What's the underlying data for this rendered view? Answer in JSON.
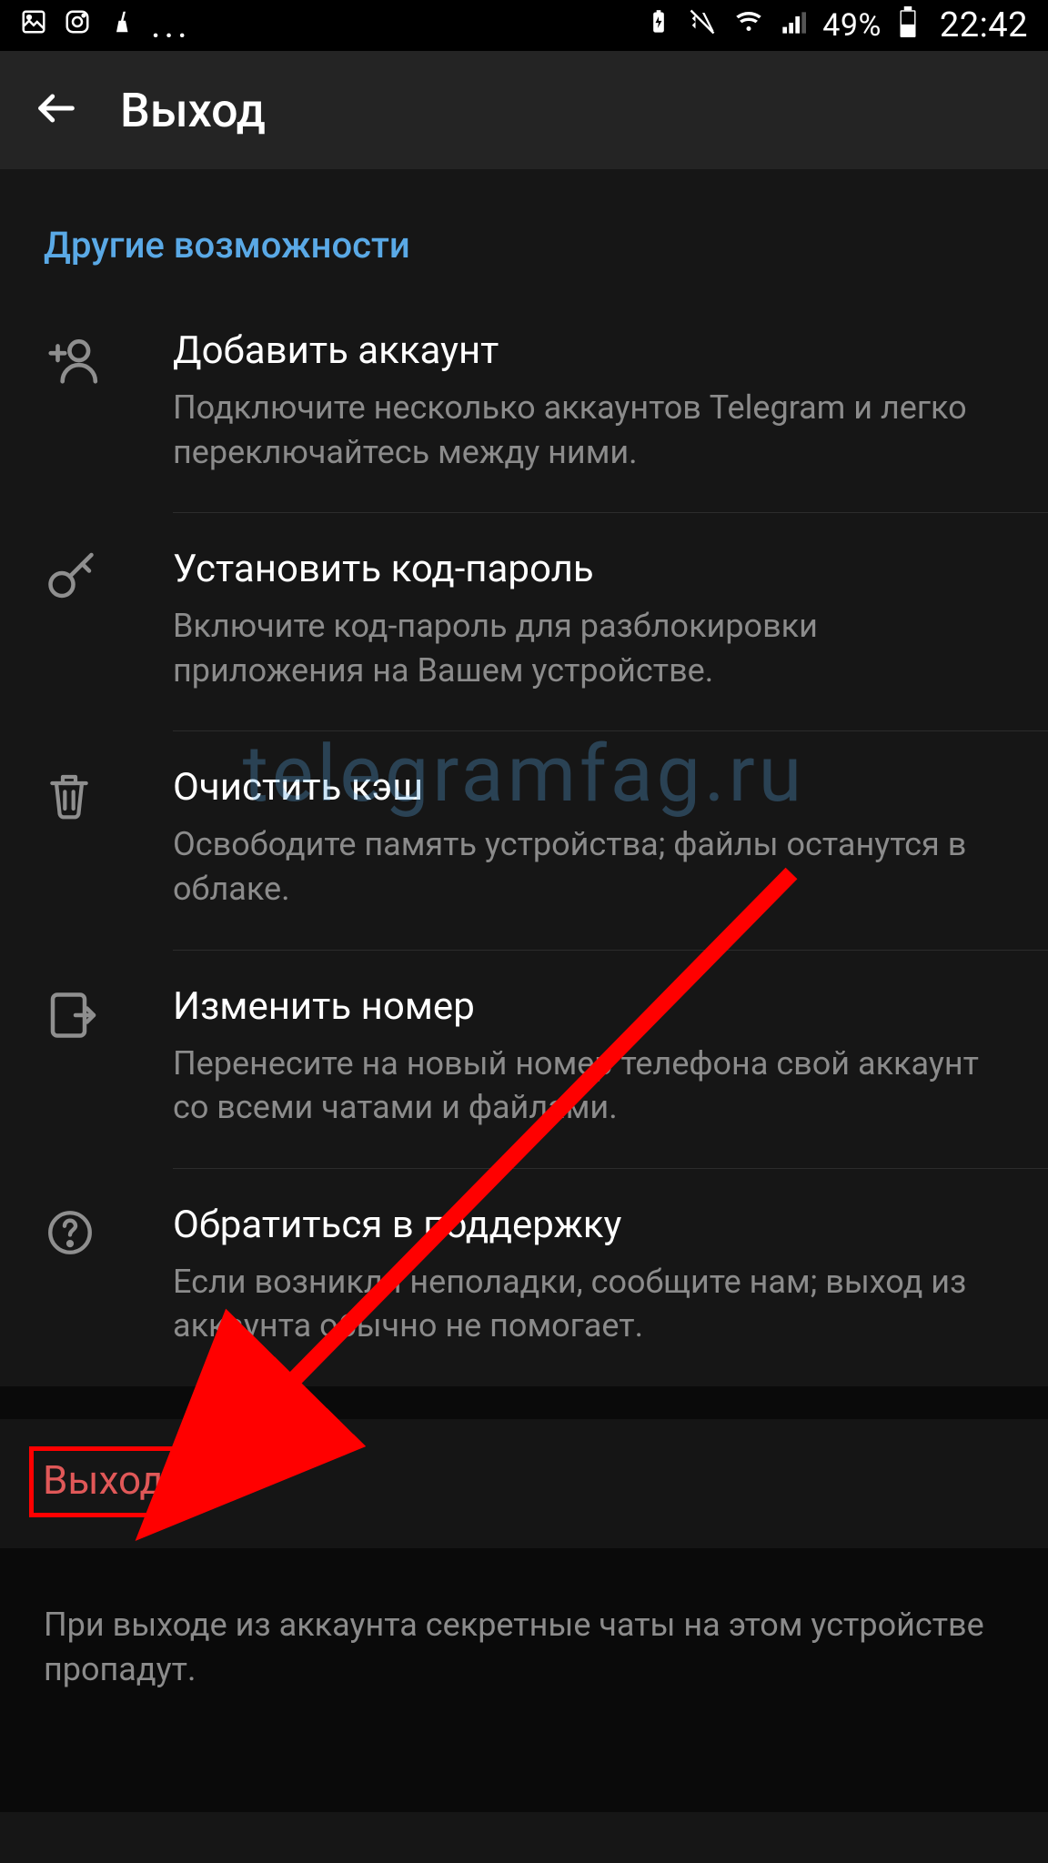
{
  "status": {
    "battery_pct": "49%",
    "clock": "22:42"
  },
  "header": {
    "title": "Выход"
  },
  "section": {
    "heading": "Другие возможности"
  },
  "items": {
    "add_account": {
      "title": "Добавить аккаунт",
      "sub": "Подключите несколько аккаунтов Telegram и легко переключайтесь между ними."
    },
    "passcode": {
      "title": "Установить код-пароль",
      "sub": "Включите код-пароль для разблокировки приложения на Вашем устройстве."
    },
    "clear_cache": {
      "title": "Очистить кэш",
      "sub": "Освободите память устройства; файлы останутся в облаке."
    },
    "change_number": {
      "title": "Изменить номер",
      "sub": "Перенесите на новый номер телефона свой аккаунт со всеми чатами и файлами."
    },
    "support": {
      "title": "Обратиться в поддержку",
      "sub": "Если возникли неполадки, сообщите нам; выход из аккаунта обычно не помогает."
    }
  },
  "logout": {
    "label": "Выход"
  },
  "footer": {
    "note": "При выходе из аккаунта секретные чаты на этом устройстве пропадут."
  },
  "watermark": "telegramfag.ru"
}
